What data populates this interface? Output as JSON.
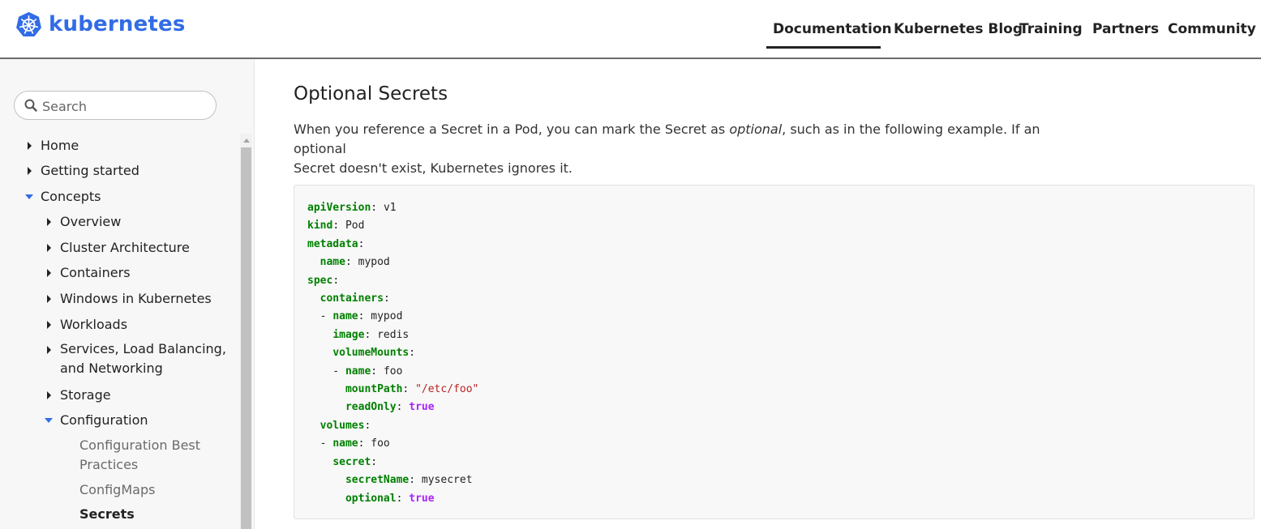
{
  "header": {
    "brand": "kubernetes",
    "nav": [
      "Documentation",
      "Kubernetes Blog",
      "Training",
      "Partners",
      "Community"
    ],
    "active_nav": "Documentation"
  },
  "sidebar": {
    "search_placeholder": "Search",
    "items": [
      {
        "label": "Home",
        "state": "collapsed"
      },
      {
        "label": "Getting started",
        "state": "collapsed"
      },
      {
        "label": "Concepts",
        "state": "expanded"
      },
      {
        "label": "Overview",
        "state": "collapsed"
      },
      {
        "label": "Cluster Architecture",
        "state": "collapsed"
      },
      {
        "label": "Containers",
        "state": "collapsed"
      },
      {
        "label": "Windows in Kubernetes",
        "state": "collapsed"
      },
      {
        "label": "Workloads",
        "state": "collapsed"
      },
      {
        "label": "Services, Load Balancing,",
        "label2": "and Networking",
        "state": "collapsed"
      },
      {
        "label": "Storage",
        "state": "collapsed"
      },
      {
        "label": "Configuration",
        "state": "expanded"
      },
      {
        "label": "Configuration Best",
        "label2": "Practices"
      },
      {
        "label": "ConfigMaps"
      },
      {
        "label": "Secrets",
        "state": "active"
      }
    ]
  },
  "main": {
    "heading": "Optional Secrets",
    "para_before": "When you reference a Secret in a Pod, you can mark the Secret as ",
    "para_em": "optional",
    "para_after": ", such as in the following example. If an optional",
    "para_line2": "Secret doesn't exist, Kubernetes ignores it.",
    "code": {
      "apiVersion": "v1",
      "kind": "Pod",
      "metadata_name": "mypod",
      "container_name": "mypod",
      "image": "redis",
      "mount_name": "foo",
      "mountPath": "\"/etc/foo\"",
      "readOnly": "true",
      "volume_name": "foo",
      "secretName": "mysecret",
      "optional": "true"
    }
  },
  "colors": {
    "brand": "#326ce5",
    "yaml_key": "#008000",
    "yaml_string": "#ba2121",
    "yaml_bool": "#aa22ff"
  }
}
